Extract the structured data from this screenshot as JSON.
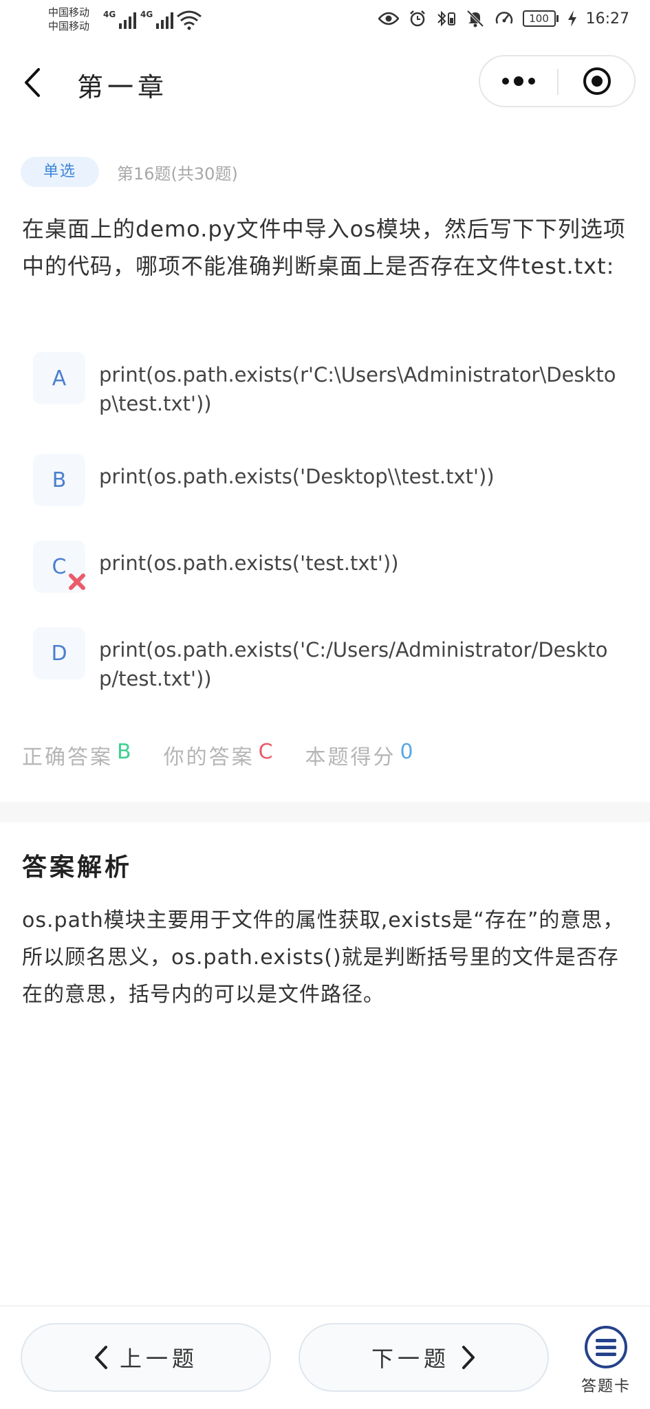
{
  "status_bar": {
    "carrier_1": "中国移动",
    "carrier_2": "中国移动",
    "network_1": "4G",
    "network_2": "4G",
    "battery": "100",
    "time": "16:27"
  },
  "nav": {
    "title": "第一章"
  },
  "question": {
    "type_badge": "单选",
    "progress": "第16题(共30题)",
    "text": "在桌面上的demo.py文件中导入os模块，然后写下下列选项中的代码，哪项不能准确判断桌面上是否存在文件test.txt:"
  },
  "options": [
    {
      "letter": "A",
      "text": "print(os.path.exists(r'C:\\Users\\Administrator\\Desktop\\test.txt'))"
    },
    {
      "letter": "B",
      "text": "print(os.path.exists('Desktop\\\\test.txt'))"
    },
    {
      "letter": "C",
      "text": "print(os.path.exists('test.txt'))",
      "mark": "wrong"
    },
    {
      "letter": "D",
      "text": "print(os.path.exists('C:/Users/Administrator/Desktop/test.txt'))"
    }
  ],
  "result": {
    "correct_label": "正确答案",
    "correct_value": "B",
    "yours_label": "你的答案",
    "yours_value": "C",
    "score_label": "本题得分",
    "score_value": "0"
  },
  "analysis": {
    "title": "答案解析",
    "text": "os.path模块主要用于文件的属性获取,exists是“存在”的意思，所以顾名思义，os.path.exists()就是判断括号里的文件是否存在的意思，括号内的可以是文件路径。"
  },
  "bottom": {
    "prev_label": "上一题",
    "next_label": "下一题",
    "card_label": "答题卡"
  },
  "colors": {
    "accent": "#3d84da",
    "correct": "#3ecf8e",
    "wrong": "#ea5b6b",
    "score": "#5aa7e5"
  }
}
